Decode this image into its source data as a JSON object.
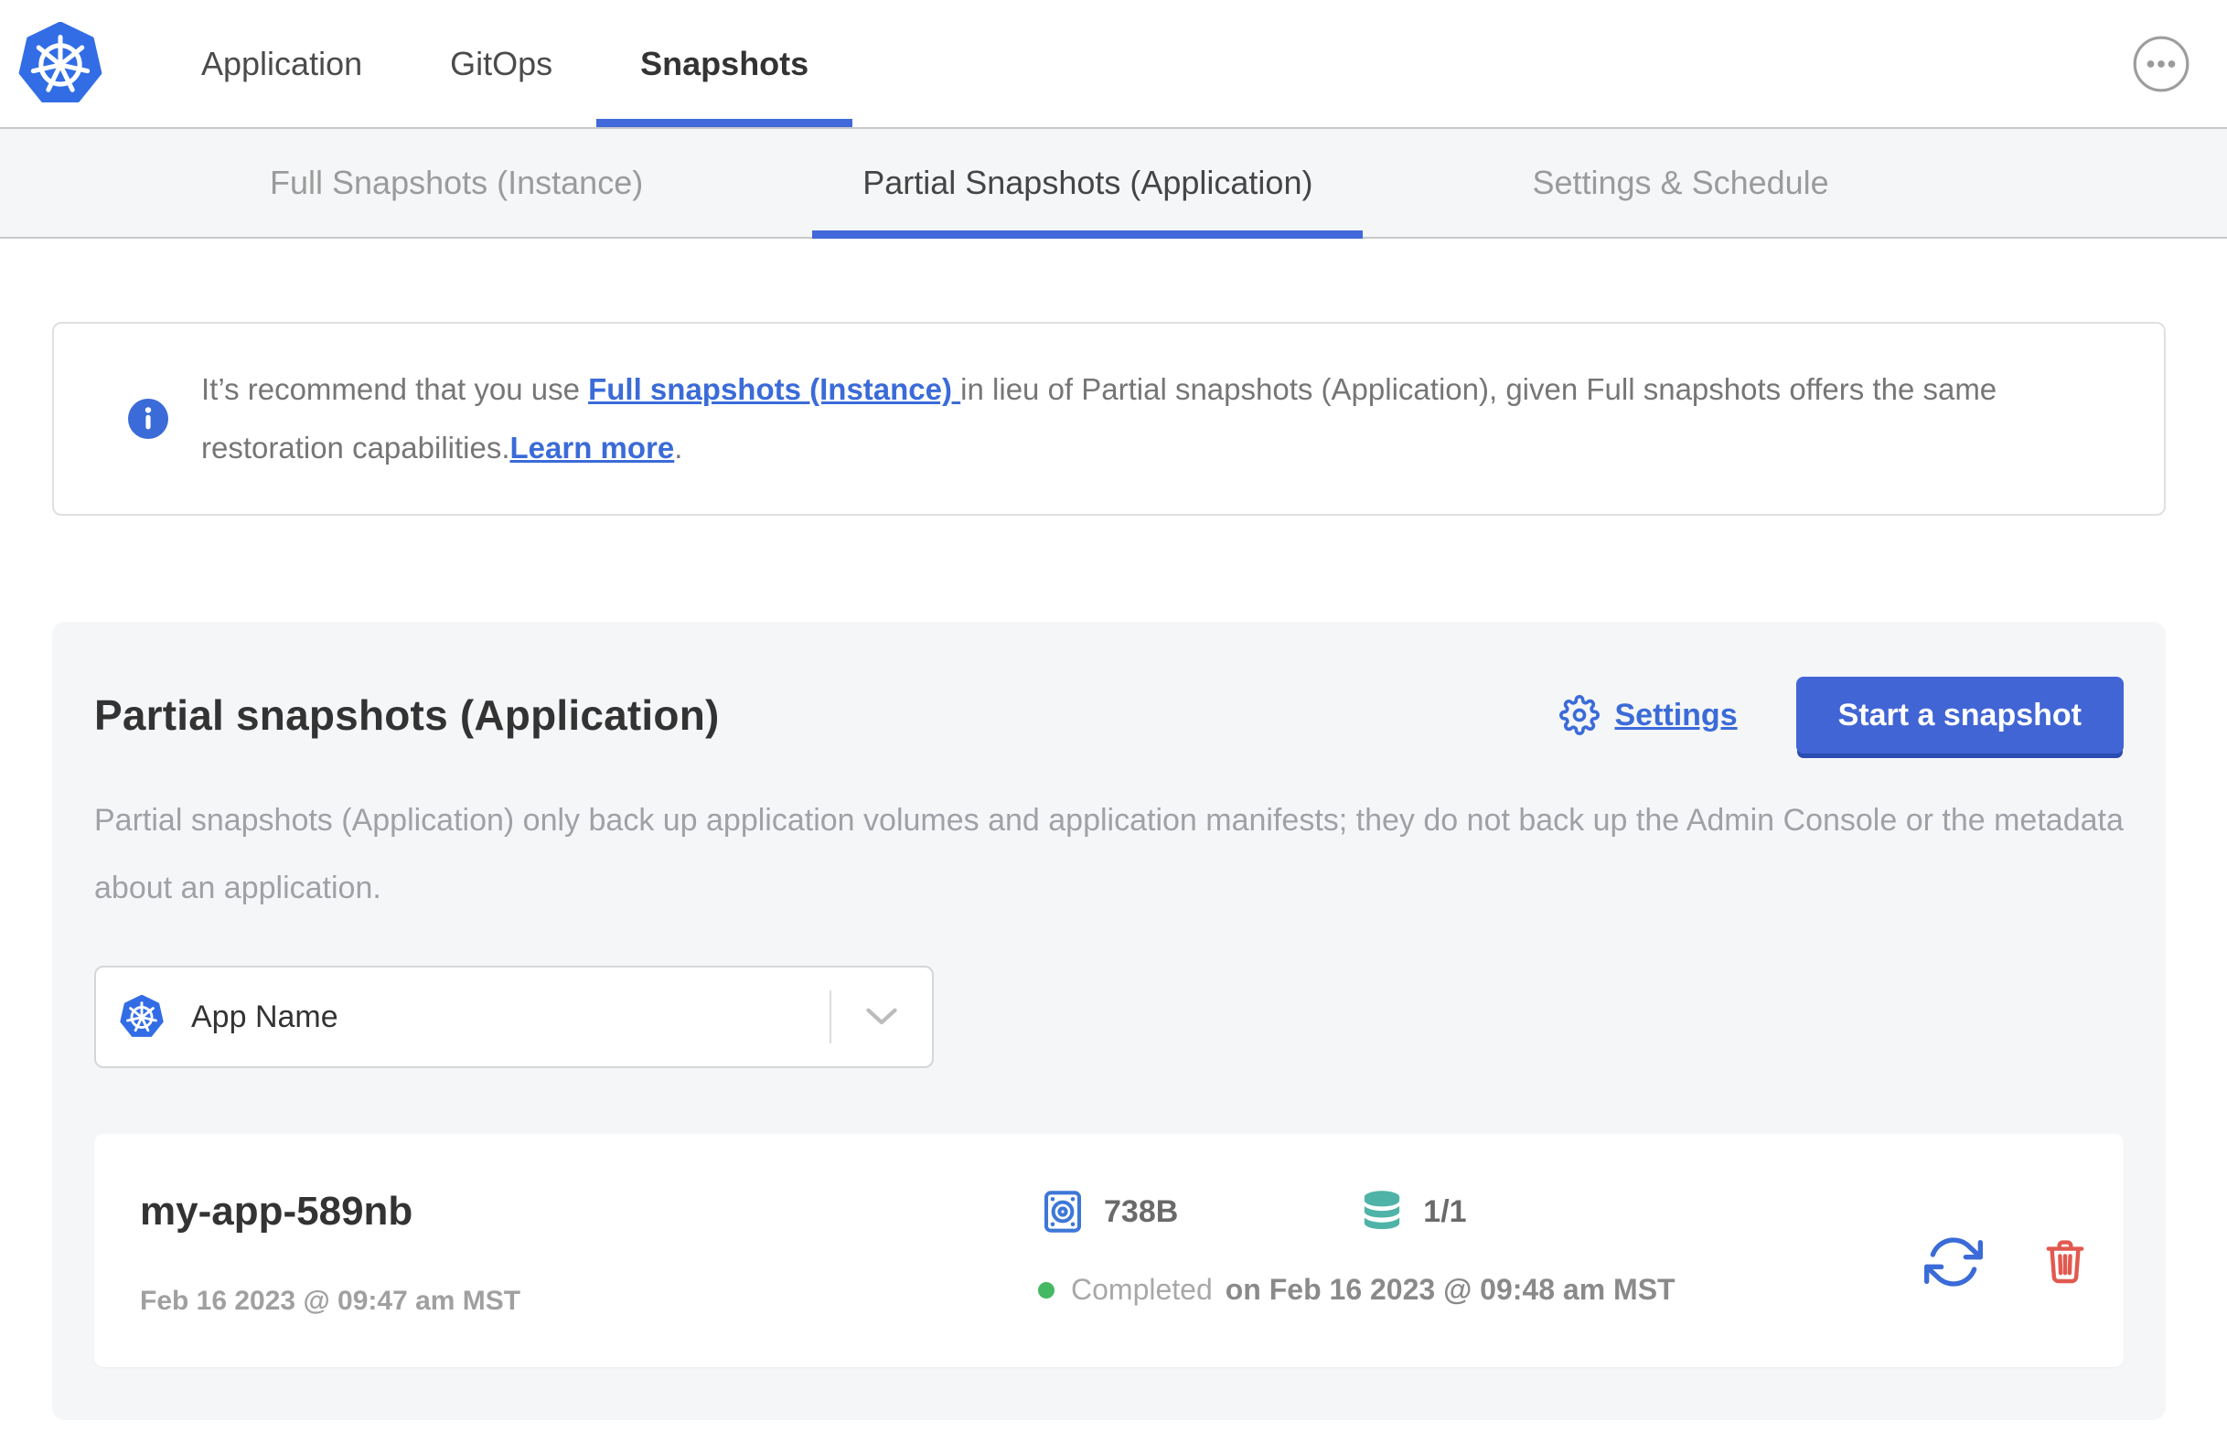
{
  "header": {
    "nav_items": [
      {
        "label": "Application",
        "active": false
      },
      {
        "label": "GitOps",
        "active": false
      },
      {
        "label": "Snapshots",
        "active": true
      }
    ],
    "overflow_menu_icon": "ellipsis-circle-icon"
  },
  "tabs": [
    {
      "label": "Full Snapshots (Instance)",
      "active": false
    },
    {
      "label": "Partial Snapshots (Application)",
      "active": true
    },
    {
      "label": "Settings & Schedule",
      "active": false
    }
  ],
  "info_banner": {
    "icon": "info-icon",
    "segment_1": "It’s recommend that you use ",
    "link_full_snapshots": "Full snapshots (Instance) ",
    "segment_2": "in lieu of Partial snapshots (Application), given Full snapshots offers the same restoration capabilities.",
    "link_learn_more": "Learn more",
    "segment_3": "."
  },
  "panel": {
    "title": "Partial snapshots (Application)",
    "settings_link": "Settings",
    "start_snapshot_button": "Start a snapshot",
    "description": "Partial snapshots (Application) only back up application volumes and application manifests; they do not back up the Admin Console or the metadata about an application.",
    "app_selector": {
      "icon": "kubernetes-icon",
      "value": "App Name"
    }
  },
  "snapshots": [
    {
      "name": "my-app-589nb",
      "started": "Feb 16 2023 @ 09:47 am MST",
      "size": "738B",
      "volumes": "1/1",
      "status": "Completed",
      "completed_at": "on Feb 16 2023 @ 09:48 am MST"
    }
  ],
  "colors": {
    "accent_blue": "#3b6bd8",
    "button_blue": "#4165d4",
    "active_underline_blue": "#4169d9",
    "kubernetes_blue": "#326de6",
    "disk_icon_blue": "#3d78d8",
    "volumes_teal": "#4fb3a8",
    "danger_red": "#e25950",
    "success_green": "#44b863",
    "panel_background": "#f5f6f8"
  }
}
